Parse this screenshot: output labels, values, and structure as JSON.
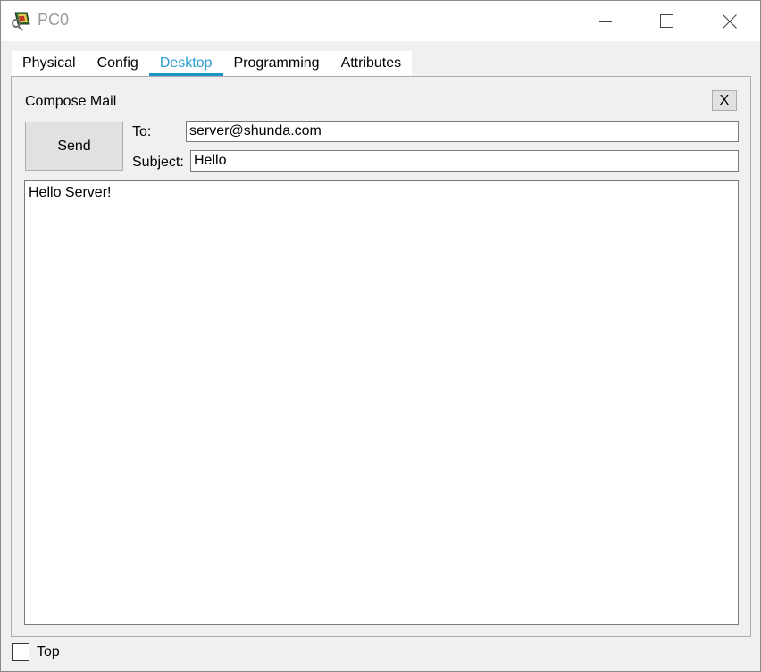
{
  "window": {
    "title": "PC0",
    "icon": "pc-icon"
  },
  "tabs": [
    {
      "label": "Physical",
      "active": false
    },
    {
      "label": "Config",
      "active": false
    },
    {
      "label": "Desktop",
      "active": true
    },
    {
      "label": "Programming",
      "active": false
    },
    {
      "label": "Attributes",
      "active": false
    }
  ],
  "compose": {
    "title": "Compose Mail",
    "close_label": "X",
    "send_label": "Send",
    "to_label": "To:",
    "to_value": "server@shunda.com",
    "subject_label": "Subject:",
    "subject_value": "Hello",
    "body_value": "Hello Server!"
  },
  "footer": {
    "top_label": "Top",
    "top_checked": false
  },
  "colors": {
    "accent": "#1d95c8",
    "active_tab_text": "#2a9fd0"
  }
}
